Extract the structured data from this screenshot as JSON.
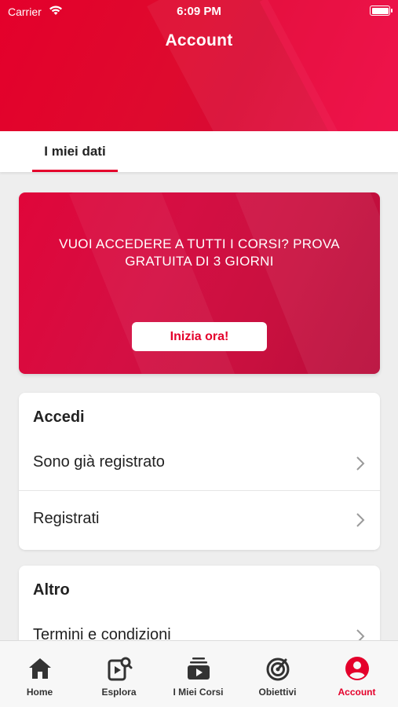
{
  "status_bar": {
    "carrier": "Carrier",
    "time": "6:09 PM"
  },
  "header": {
    "title": "Account"
  },
  "tabs": [
    {
      "label": "I miei dati",
      "active": true
    }
  ],
  "promo": {
    "text": "VUOI ACCEDERE A TUTTI I CORSI? PROVA GRATUITA DI 3 GIORNI",
    "button_label": "Inizia ora!"
  },
  "login_section": {
    "title": "Accedi",
    "items": [
      {
        "label": "Sono già registrato",
        "icon": "chevron-right-icon"
      },
      {
        "label": "Registrati",
        "icon": "chevron-right-icon"
      }
    ]
  },
  "other_section": {
    "title": "Altro",
    "items": [
      {
        "label": "Termini e condizioni",
        "icon": "chevron-right-icon"
      }
    ]
  },
  "bottom_nav": [
    {
      "label": "Home",
      "icon": "home-icon"
    },
    {
      "label": "Esplora",
      "icon": "explore-icon"
    },
    {
      "label": "I Miei Corsi",
      "icon": "my-courses-icon"
    },
    {
      "label": "Obiettivi",
      "icon": "goals-icon"
    },
    {
      "label": "Account",
      "icon": "account-icon",
      "active": true
    }
  ],
  "colors": {
    "accent": "#e4002b",
    "background": "#eeeeee"
  }
}
